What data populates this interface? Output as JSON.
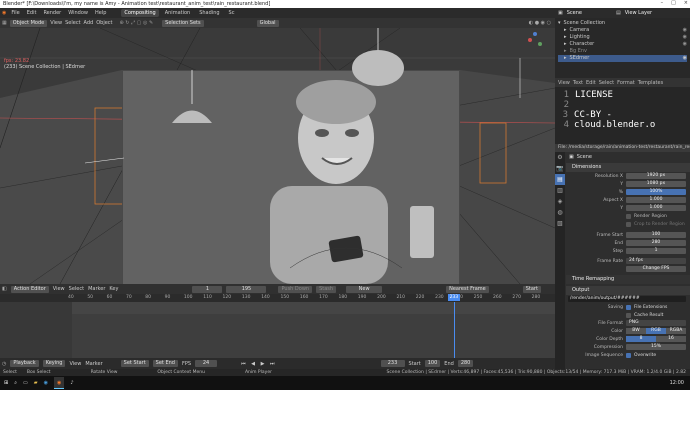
{
  "window": {
    "title": "Blender* [F:\\Downloads\\I'm, my name is Amy - Animation test\\restaurant_anim_test\\rain_restaurant.blend]"
  },
  "menu": {
    "items": [
      "File",
      "Edit",
      "Render",
      "Window",
      "Help"
    ]
  },
  "workspaces": {
    "items": [
      "Compositing",
      "Animation",
      "Shading",
      "Sc"
    ],
    "active": "Compositing"
  },
  "scene_selector": {
    "label": "Scene"
  },
  "view_layer": {
    "label": "View Layer"
  },
  "viewport_header": {
    "mode": "Object Mode",
    "menus": [
      "View",
      "Select",
      "Add",
      "Object"
    ],
    "selection_sets": "Selection Sets",
    "orientation": "Global"
  },
  "viewport_overlay": {
    "fps": "fps: 23.82",
    "collection": "(233) Scene Collection | SEdrner"
  },
  "outliner": {
    "rows": [
      {
        "label": "Scene Collection",
        "selected": false
      },
      {
        "label": "Camera",
        "selected": false
      },
      {
        "label": "Lighting",
        "selected": false
      },
      {
        "label": "Character",
        "selected": false
      },
      {
        "label": "Bg Env",
        "selected": false
      },
      {
        "label": "SEdrner",
        "selected": true
      }
    ]
  },
  "text_editor": {
    "menus": [
      "View",
      "Text",
      "Edit",
      "Select",
      "Format",
      "Templates"
    ],
    "lines": [
      {
        "num": "1",
        "text": "LICENSE"
      },
      {
        "num": "2",
        "text": ""
      },
      {
        "num": "3",
        "text": "CC-BY - cloud.blender.o"
      },
      {
        "num": "4",
        "text": ""
      }
    ]
  },
  "file_path": "File: /media/storage/rain/animation-test/restaurant/rain_restaurant_pack",
  "properties": {
    "scene_label": "Scene",
    "dimensions_title": "Dimensions",
    "resolution_x": {
      "label": "Resolution X",
      "value": "1920 px"
    },
    "resolution_y": {
      "label": "Y",
      "value": "1080 px"
    },
    "resolution_pct": {
      "label": "%",
      "value": "100%"
    },
    "aspect_x": {
      "label": "Aspect X",
      "value": "1.000"
    },
    "aspect_y": {
      "label": "Y",
      "value": "1.000"
    },
    "render_region": "Render Region",
    "crop_region": "Crop to Render Region",
    "frame_start": {
      "label": "Frame Start",
      "value": "100"
    },
    "frame_end": {
      "label": "End",
      "value": "280"
    },
    "frame_step": {
      "label": "Step",
      "value": "1"
    },
    "frame_rate": {
      "label": "Frame Rate",
      "value": "24 fps"
    },
    "change_fps": "Change FPS",
    "time_remapping": "Time Remapping",
    "output_title": "Output",
    "output_path": "/render/anim/output/######",
    "saving": {
      "label": "Saving",
      "value": "File Extensions"
    },
    "cache_result": "Cache Result",
    "file_format": {
      "label": "File Format",
      "value": "PNG"
    },
    "color": {
      "label": "Color",
      "options": [
        "BW",
        "RGB",
        "RGBA"
      ],
      "active": "RGB"
    },
    "color_depth": {
      "label": "Color Depth",
      "options": [
        "8",
        "16"
      ],
      "active": "8"
    },
    "compression": {
      "label": "Compression",
      "value": "15%"
    },
    "image_sequence": {
      "label": "Image Sequence",
      "value": "Overwrite"
    }
  },
  "action_editor": {
    "editor": "Action Editor",
    "menus": [
      "View",
      "Select",
      "Marker",
      "Key"
    ],
    "frame_start": "1",
    "frame_end": "195",
    "push_down": "Push Down",
    "stash": "Stash",
    "new": "New",
    "snap": "Nearest Frame",
    "ruler_labels": [
      "40",
      "50",
      "60",
      "70",
      "80",
      "90",
      "100",
      "110",
      "120",
      "130",
      "140",
      "150",
      "160",
      "170",
      "180",
      "190",
      "200",
      "210",
      "220",
      "230",
      "240",
      "250",
      "260",
      "270",
      "280"
    ],
    "current_frame": "233",
    "current_frame_fraction": 0.79
  },
  "playback_bar": {
    "items": [
      "Playback",
      "Keying",
      "View",
      "Marker"
    ],
    "set_start": "Set Start",
    "set_end": "Set End",
    "fps_label": "FPS",
    "fps": "24",
    "current": "233",
    "start_label": "Start",
    "start": "100",
    "end_label": "End",
    "end": "280"
  },
  "statusbar": {
    "left": [
      "Select",
      "Box Select",
      "Rotate View",
      "Object Context Menu",
      "Anim Player"
    ],
    "right": "Scene Collection | SEdrner | Verts:46,897 | Faces:45,536 | Tris:90,880 | Objects:13/54 | Memory: 717.3 MiB | VRAM: 1.2/4.0 GiB | 2.82"
  },
  "taskbar": {
    "time": "12:00"
  },
  "colors": {
    "accent": "#4772b3",
    "playhead": "#4a8cf0",
    "frame_range": "#d07830"
  }
}
